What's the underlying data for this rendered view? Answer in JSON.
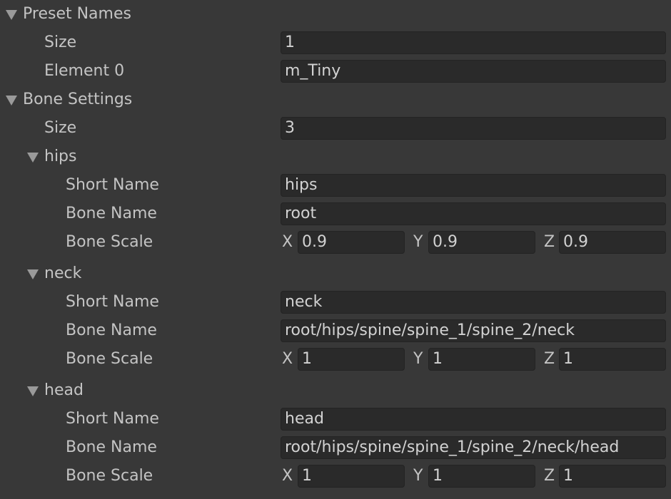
{
  "preset_names": {
    "label": "Preset Names",
    "size_label": "Size",
    "size_value": "1",
    "elements": [
      {
        "label": "Element 0",
        "value": "m_Tiny"
      }
    ]
  },
  "bone_settings": {
    "label": "Bone Settings",
    "size_label": "Size",
    "size_value": "3",
    "bones": [
      {
        "label": "hips",
        "short_name_label": "Short Name",
        "short_name": "hips",
        "bone_name_label": "Bone Name",
        "bone_name": "root",
        "bone_scale_label": "Bone Scale",
        "x_label": "X",
        "x": "0.9",
        "y_label": "Y",
        "y": "0.9",
        "z_label": "Z",
        "z": "0.9"
      },
      {
        "label": "neck",
        "short_name_label": "Short Name",
        "short_name": "neck",
        "bone_name_label": "Bone Name",
        "bone_name": "root/hips/spine/spine_1/spine_2/neck",
        "bone_scale_label": "Bone Scale",
        "x_label": "X",
        "x": "1",
        "y_label": "Y",
        "y": "1",
        "z_label": "Z",
        "z": "1"
      },
      {
        "label": "head",
        "short_name_label": "Short Name",
        "short_name": "head",
        "bone_name_label": "Bone Name",
        "bone_name": "root/hips/spine/spine_1/spine_2/neck/head",
        "bone_scale_label": "Bone Scale",
        "x_label": "X",
        "x": "1",
        "y_label": "Y",
        "y": "1",
        "z_label": "Z",
        "z": "1"
      }
    ]
  },
  "colors": {
    "background": "#383838",
    "field_background": "#2a2a2a",
    "label_text": "#c4c4c4",
    "field_text": "#d2d2d2",
    "foldout_arrow": "#9a9a9a"
  },
  "icons": {
    "foldout": "triangle-down-icon"
  }
}
